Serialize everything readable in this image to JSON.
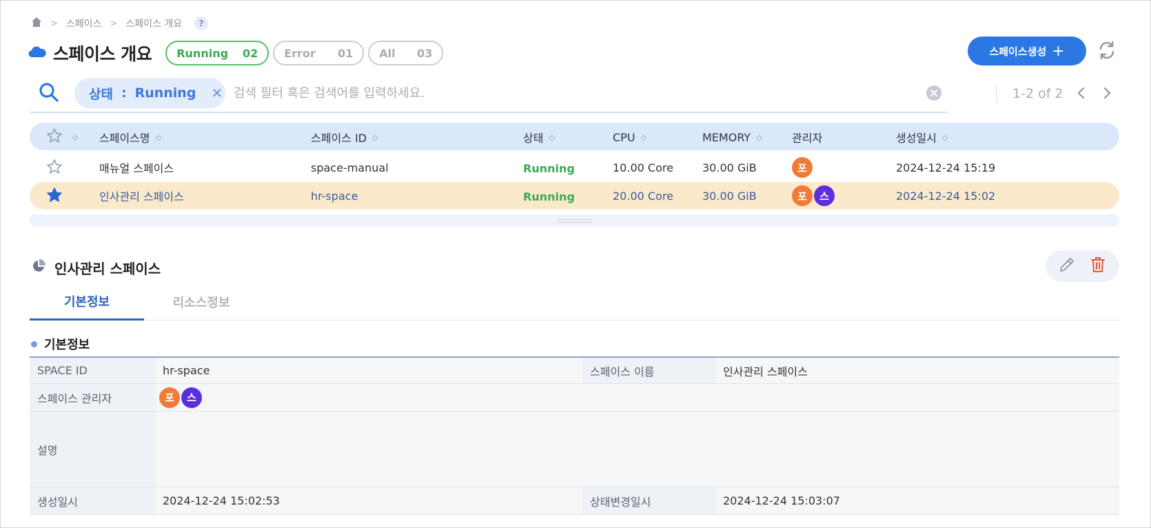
{
  "breadcrumb": {
    "home_icon": "home-icon",
    "level1": "스페이스",
    "level2": "스페이스 개요",
    "help": "?"
  },
  "header": {
    "title": "스페이스 개요",
    "filters": [
      {
        "label": "Running",
        "count": "02"
      },
      {
        "label": "Error",
        "count": "01"
      },
      {
        "label": "All",
        "count": "03"
      }
    ],
    "create_button": "스페이스생성",
    "create_plus": "+"
  },
  "search": {
    "chip_key": "상태",
    "chip_sep": ":",
    "chip_value": "Running",
    "chip_close": "✕",
    "placeholder": "검색 필터 혹은 검색어를 입력하세요.",
    "pager": "1-2 of 2"
  },
  "table": {
    "columns": [
      "스페이스명",
      "스페이스 ID",
      "상태",
      "CPU",
      "MEMORY",
      "관리자",
      "생성일시"
    ],
    "rows": [
      {
        "starred": false,
        "name": "매뉴얼 스페이스",
        "id": "space-manual",
        "status": "Running",
        "cpu": "10.00 Core",
        "memory": "30.00 GiB",
        "admins": [
          "포"
        ],
        "created": "2024-12-24 15:19"
      },
      {
        "starred": true,
        "name": "인사관리 스페이스",
        "id": "hr-space",
        "status": "Running",
        "cpu": "20.00 Core",
        "memory": "30.00 GiB",
        "admins": [
          "포",
          "스"
        ],
        "created": "2024-12-24 15:02"
      }
    ]
  },
  "detail": {
    "title": "인사관리 스페이스",
    "tabs": [
      "기본정보",
      "리소스정보"
    ],
    "section_title": "기본정보",
    "labels": {
      "space_id": "SPACE ID",
      "space_name": "스페이스 이름",
      "admins": "스페이스 관리자",
      "description": "설명",
      "created": "생성일시",
      "status_changed": "상태변경일시"
    },
    "values": {
      "space_id": "hr-space",
      "space_name": "인사관리 스페이스",
      "admins": [
        "포",
        "스"
      ],
      "description": "",
      "created": "2024-12-24 15:02:53",
      "status_changed": "2024-12-24 15:03:07"
    }
  },
  "colors": {
    "accent": "#2b78e4",
    "running": "#3caa52",
    "selected_row": "#faeacb",
    "header_bg": "#dbe7fb",
    "avatar_orange": "#f07a36",
    "avatar_purple": "#5b2ee0"
  }
}
